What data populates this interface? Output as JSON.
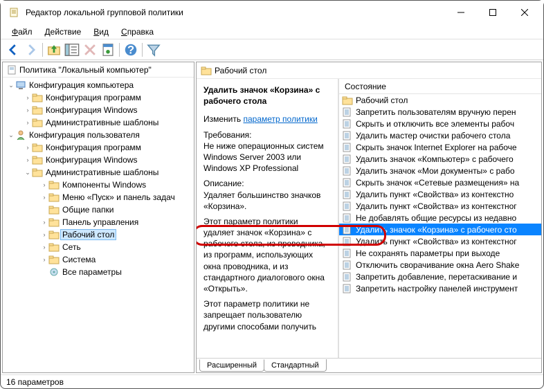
{
  "window": {
    "title": "Редактор локальной групповой политики"
  },
  "menu": {
    "file": "Файл",
    "action": "Действие",
    "view": "Вид",
    "help": "Справка"
  },
  "tree": {
    "root": "Политика \"Локальный компьютер\"",
    "computer_cfg": "Конфигурация компьютера",
    "cc_programs": "Конфигурация программ",
    "cc_windows": "Конфигурация Windows",
    "cc_admin": "Административные шаблоны",
    "user_cfg": "Конфигурация пользователя",
    "uc_programs": "Конфигурация программ",
    "uc_windows": "Конфигурация Windows",
    "uc_admin": "Административные шаблоны",
    "comp_win": "Компоненты Windows",
    "start_menu": "Меню «Пуск» и панель задач",
    "shared": "Общие папки",
    "control_panel": "Панель управления",
    "desktop": "Рабочий стол",
    "network": "Сеть",
    "system": "Система",
    "all_params": "Все параметры"
  },
  "pane_title": "Рабочий стол",
  "detail": {
    "title": "Удалить значок «Корзина» с рабочего стола",
    "edit_label": "Изменить",
    "edit_link": "параметр политики",
    "req_label": "Требования:",
    "req_text": "Не ниже операционных систем Windows Server 2003 или Windows XP Professional",
    "desc_label": "Описание:",
    "desc_text": "Удаляет большинство значков «Корзина».",
    "para1": "Этот параметр политики удаляет значок «Корзина» с рабочего стола, из проводника, из программ, использующих окна проводника, и из стандартного диалогового окна «Открыть».",
    "para2": "Этот параметр политики не запрещает пользователю другими способами получить"
  },
  "list": {
    "header": "Состояние",
    "items": [
      "Рабочий стол",
      "Запретить пользователям вручную перен",
      "Скрыть и отключить все элементы рабоч",
      "Удалить мастер очистки рабочего стола",
      "Скрыть значок Internet Explorer на рабоче",
      "Удалить значок «Компьютер» с рабочего",
      "Удалить значок «Мои документы» с рабо",
      "Скрыть значок «Сетевые размещения» на",
      "Удалить пункт «Свойства» из контекстно",
      "Удалить пункт «Свойства» из контекстног",
      "Не добавлять общие ресурсы из недавно",
      "Удалить значок «Корзина» с рабочего сто",
      "Удалить пункт «Свойства» из контекстног",
      "Не сохранять параметры при выходе",
      "Отключить сворачивание окна Aero Shake",
      "Запретить добавление, перетаскивание и",
      "Запретить настройку панелей инструмент"
    ],
    "selected_index": 11,
    "folder_index": 0
  },
  "tabs": {
    "extended": "Расширенный",
    "standard": "Стандартный"
  },
  "status": "16 параметров"
}
